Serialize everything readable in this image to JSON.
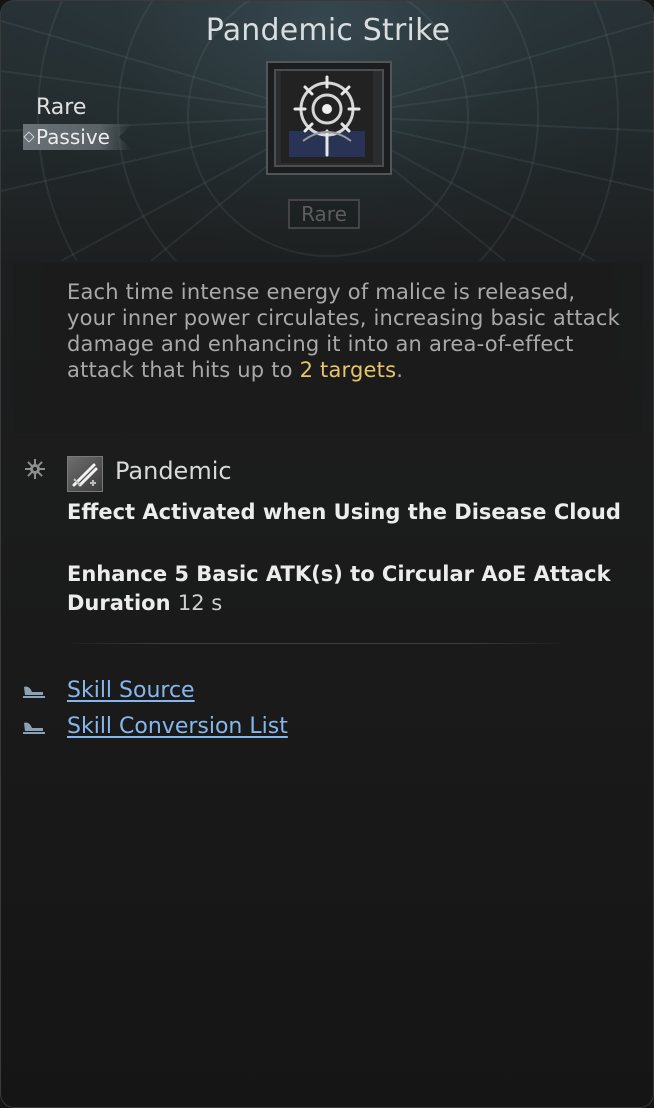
{
  "tooltip": {
    "title": "Pandemic Strike",
    "rarity": "Rare",
    "type_tag": "Passive",
    "rarity_badge": "Rare",
    "skill_icon": "spiked-wheel-icon",
    "description": {
      "text_before": "Each time intense energy of malice is released, your inner power circulates, increasing basic attack damage and enhancing it into an area-of-effect attack that hits up to ",
      "highlight": "2 targets",
      "text_after": "."
    },
    "effect": {
      "icon": "crossed-swords-icon",
      "bullet_icon": "gear-icon",
      "name": "Pandemic",
      "line1": "Effect Activated when Using the Disease Cloud",
      "line2": "Enhance 5 Basic ATK(s) to Circular AoE Attack",
      "duration_label": "Duration",
      "duration_value": "12 s"
    },
    "links": [
      {
        "label": "Skill Source",
        "icon": "scroll-icon"
      },
      {
        "label": "Skill Conversion List",
        "icon": "scroll-icon"
      }
    ],
    "colors": {
      "highlight": "#e7c46a",
      "link": "#86b7ec",
      "description_text": "#a9a9a9"
    }
  }
}
